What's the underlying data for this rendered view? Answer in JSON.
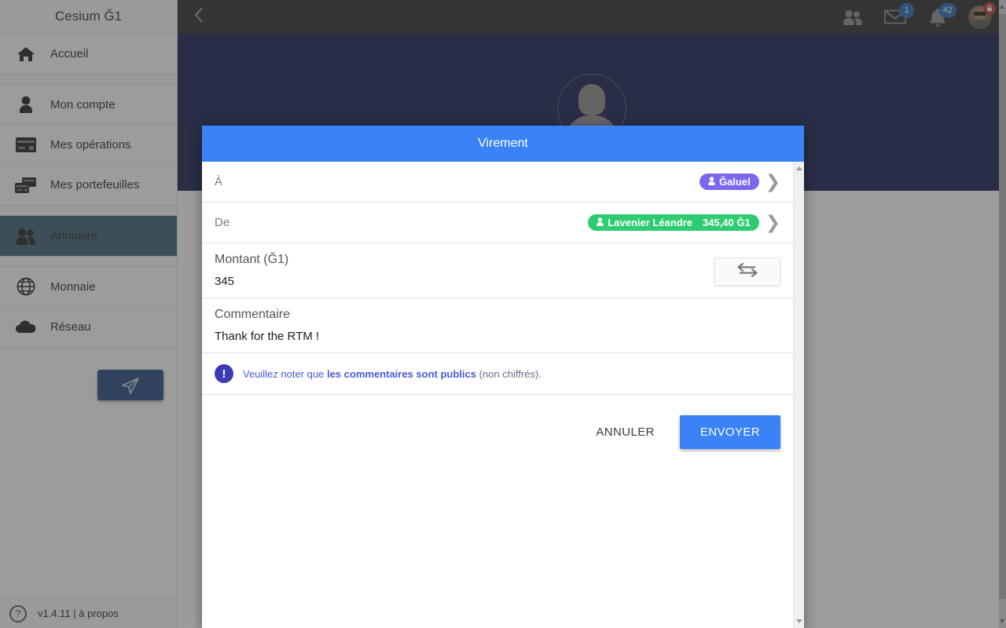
{
  "sidebar": {
    "title": "Cesium Ğ1",
    "groups": [
      {
        "items": [
          {
            "label": "Accueil",
            "icon": "home-icon",
            "active": false
          }
        ]
      },
      {
        "items": [
          {
            "label": "Mon compte",
            "icon": "user-icon",
            "active": false
          },
          {
            "label": "Mes opérations",
            "icon": "credit-card-icon",
            "active": false
          },
          {
            "label": "Mes portefeuilles",
            "icon": "wallets-icon",
            "active": false
          }
        ]
      },
      {
        "items": [
          {
            "label": "Annuaire",
            "icon": "users-icon",
            "active": true
          }
        ]
      },
      {
        "items": [
          {
            "label": "Monnaie",
            "icon": "globe-icon",
            "active": false
          },
          {
            "label": "Réseau",
            "icon": "cloud-icon",
            "active": false
          }
        ]
      }
    ],
    "fab": {
      "name": "send-transfer-fab",
      "icon": "paper-plane-icon"
    },
    "footer": {
      "icon": "help-circle-icon",
      "text": "v1.4.11 | à propos"
    }
  },
  "topbar": {
    "back_icon": "chevron-left-icon",
    "icons": [
      {
        "name": "contacts-icon",
        "badge": ""
      },
      {
        "name": "mail-icon",
        "badge": "1"
      },
      {
        "name": "bell-icon",
        "badge": "42"
      }
    ],
    "avatar": {
      "name": "avatar",
      "lock_icon": "lock-icon"
    },
    "badge_color": "#2469b8"
  },
  "hero": {
    "avatar_icon": "profile-placeholder-icon",
    "bg_color": "#0f1b4c"
  },
  "modal": {
    "title": "Virement",
    "accent_color": "#3b82f6",
    "to": {
      "label": "À",
      "chip": {
        "name": "Ğaluel",
        "color": "#7b68ee",
        "icon": "person-icon"
      },
      "chevron": "chevron-right-icon"
    },
    "from": {
      "label": "De",
      "chip": {
        "name": "Lavenier Léandre",
        "amount": "345,40 Ğ1",
        "color": "#2ecc71",
        "icon": "person-icon"
      },
      "chevron": "chevron-right-icon"
    },
    "amount": {
      "label": "Montant (Ğ1)",
      "value": "345",
      "swap_icon": "exchange-arrows-icon"
    },
    "comment": {
      "label": "Commentaire",
      "value": "Thank for the RTM !"
    },
    "notice": {
      "icon": "exclamation-icon",
      "prefix": "Veuillez noter que ",
      "bold": "les commentaires sont publics",
      "suffix": " (non chiffrés)."
    },
    "actions": {
      "cancel": "ANNULER",
      "submit": "ENVOYER"
    }
  }
}
